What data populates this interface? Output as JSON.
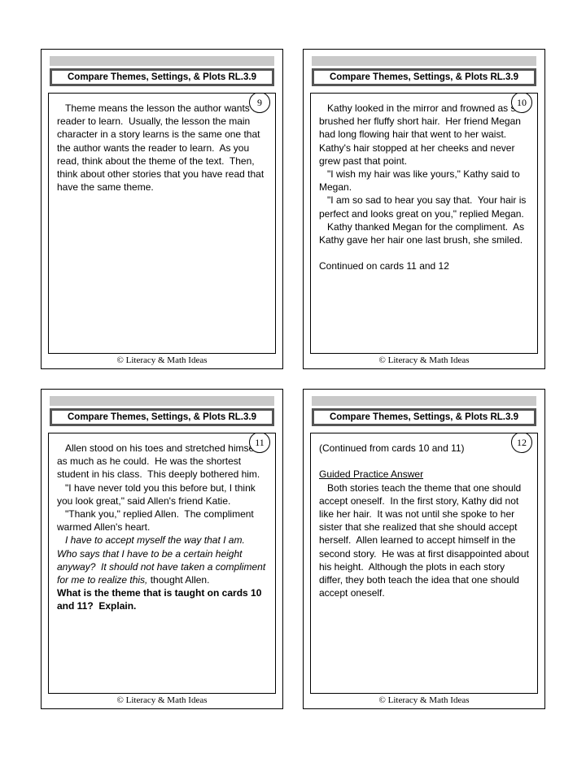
{
  "common": {
    "title": "Compare Themes, Settings, & Plots RL.3.9",
    "footer": "© Literacy & Math Ideas"
  },
  "cards": [
    {
      "number": "9",
      "segments": [
        {
          "cls": "",
          "text": "   Theme means the lesson the author wants the reader to learn.  Usually, the lesson the main character in a story learns is the same one that the author wants the reader to learn.  As you read, think about the theme of the text.  Then, think about other stories that you have read that have the same theme."
        }
      ]
    },
    {
      "number": "10",
      "segments": [
        {
          "cls": "",
          "text": "   Kathy looked in the mirror and frowned as she brushed her fluffy short hair.  Her friend Megan had long flowing hair that went to her waist.  Kathy's hair stopped at her cheeks and never grew past that point.\n   \"I wish my hair was like yours,\" Kathy said to Megan.\n   \"I am so sad to hear you say that.  Your hair is perfect and looks great on you,\" replied Megan.\n   Kathy thanked Megan for the compliment.  As Kathy gave her hair one last brush, she smiled.\n\nContinued on cards 11 and 12"
        }
      ]
    },
    {
      "number": "11",
      "segments": [
        {
          "cls": "",
          "text": "   Allen stood on his toes and stretched himself as much as he could.  He was the shortest student in his class.  This deeply bothered him.\n   \"I have never told you this before but, I think you look great,\" said Allen's friend Katie.\n   \"Thank you,\" replied Allen.  The compliment warmed Allen's heart.\n   "
        },
        {
          "cls": "italic",
          "text": "I have to accept myself the way that I am.  Who says that I have to be a certain height anyway?  It should not have taken a compliment for me to realize this,"
        },
        {
          "cls": "",
          "text": " thought Allen.\n"
        },
        {
          "cls": "bold",
          "text": "What is the theme that is taught on cards 10 and 11?  Explain."
        }
      ]
    },
    {
      "number": "12",
      "segments": [
        {
          "cls": "",
          "text": "(Continued from cards 10 and 11)\n\n"
        },
        {
          "cls": "underline",
          "text": "Guided Practice Answer"
        },
        {
          "cls": "",
          "text": "\n   Both stories teach the theme that one should accept oneself.  In the first story, Kathy did not like her hair.  It was not until she spoke to her sister that she realized that she should accept herself.  Allen learned to accept himself in the second story.  He was at first disappointed about his height.  Although the plots in each story differ, they both teach the idea that one should accept oneself."
        }
      ]
    }
  ]
}
